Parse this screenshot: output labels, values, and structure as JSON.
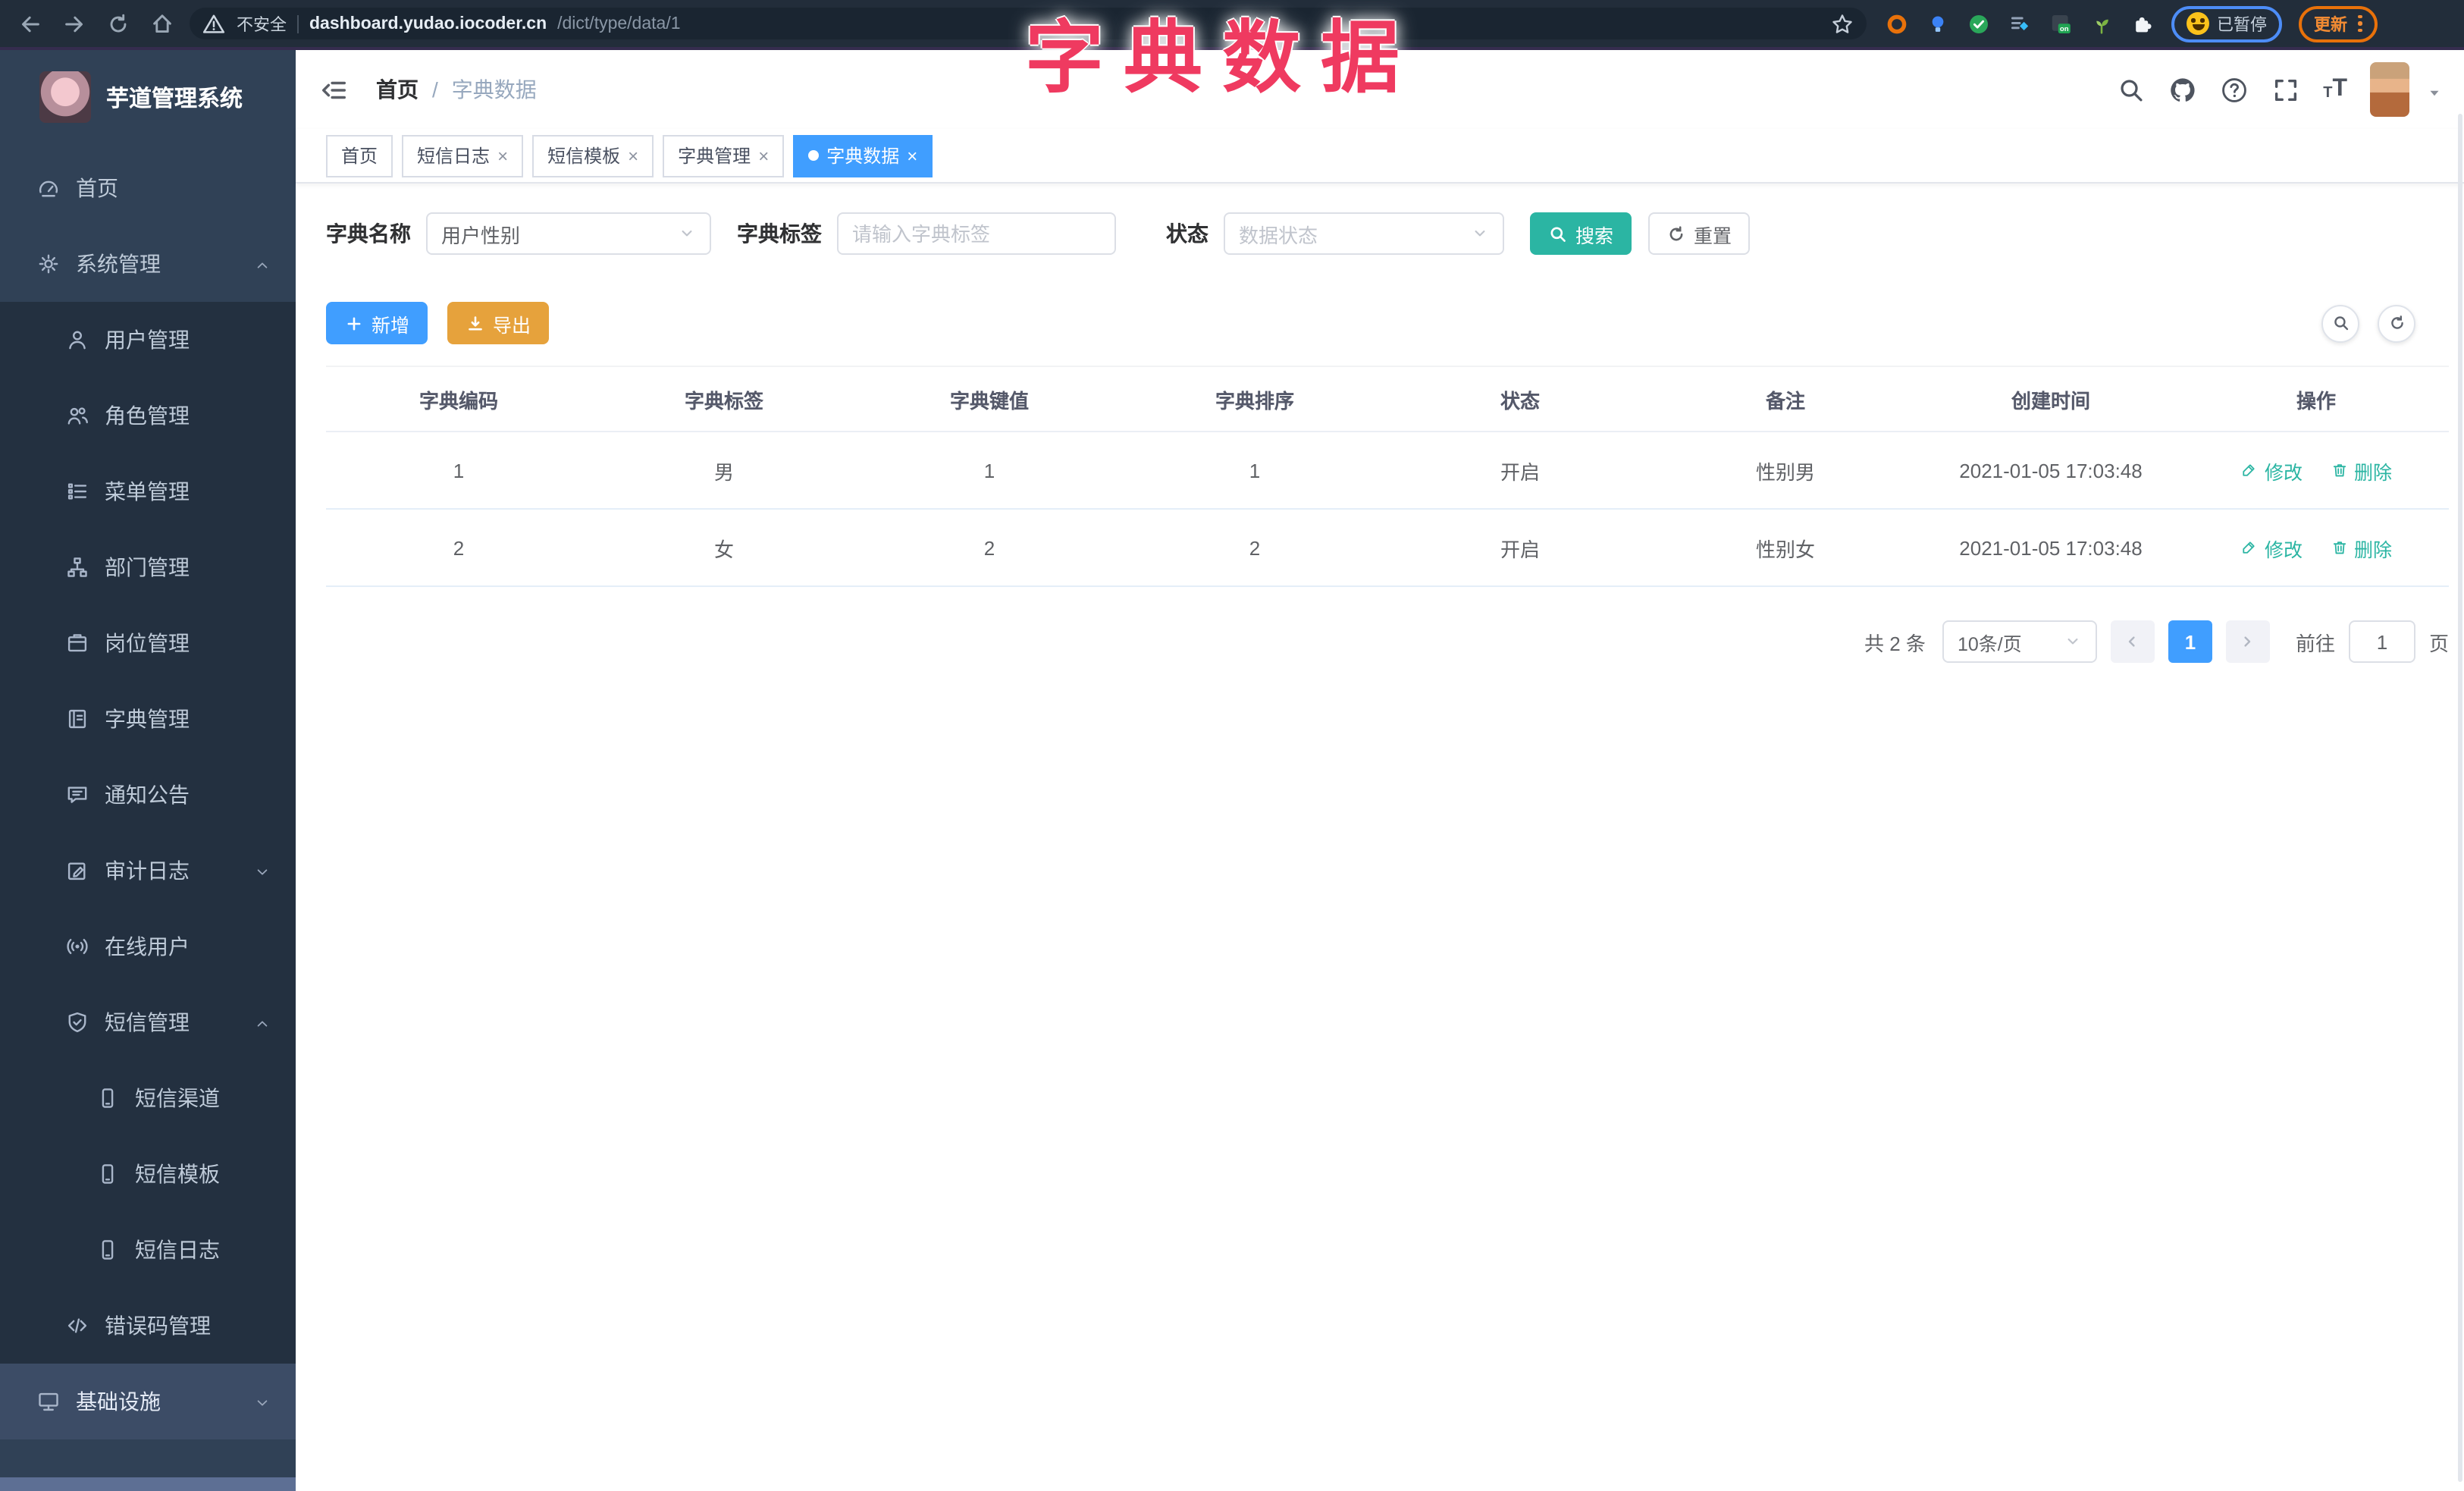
{
  "overlay": {
    "title": "字典数据"
  },
  "browser": {
    "security_text": "不安全",
    "url_domain": "dashboard.yudao.iocoder.cn",
    "url_path": "/dict/type/data/1",
    "paused_badge": "已暂停",
    "update_label": "更新"
  },
  "sidebar": {
    "logo_title": "芋道管理系统",
    "items": [
      {
        "key": "home",
        "label": "首页",
        "icon": "gauge",
        "level": 0
      },
      {
        "key": "system-management",
        "label": "系统管理",
        "icon": "gear",
        "level": 0,
        "chevron": "up"
      },
      {
        "key": "user-management",
        "label": "用户管理",
        "icon": "user",
        "level": 1
      },
      {
        "key": "role-management",
        "label": "角色管理",
        "icon": "users",
        "level": 1
      },
      {
        "key": "menu-management",
        "label": "菜单管理",
        "icon": "menu-list",
        "level": 1
      },
      {
        "key": "dept-management",
        "label": "部门管理",
        "icon": "tree",
        "level": 1
      },
      {
        "key": "post-management",
        "label": "岗位管理",
        "icon": "badge",
        "level": 1
      },
      {
        "key": "dict-management",
        "label": "字典管理",
        "icon": "book",
        "level": 1
      },
      {
        "key": "notice-management",
        "label": "通知公告",
        "icon": "megaphone",
        "level": 1
      },
      {
        "key": "audit-log",
        "label": "审计日志",
        "icon": "log",
        "level": 1,
        "chevron": "down"
      },
      {
        "key": "online-users",
        "label": "在线用户",
        "icon": "online",
        "level": 1
      },
      {
        "key": "sms-management",
        "label": "短信管理",
        "icon": "shield",
        "level": 1,
        "chevron": "up"
      },
      {
        "key": "sms-channel",
        "label": "短信渠道",
        "icon": "phone",
        "level": 2
      },
      {
        "key": "sms-template",
        "label": "短信模板",
        "icon": "phone",
        "level": 2
      },
      {
        "key": "sms-log",
        "label": "短信日志",
        "icon": "phone",
        "level": 2
      },
      {
        "key": "error-code-management",
        "label": "错误码管理",
        "icon": "code",
        "level": 1
      },
      {
        "key": "infrastructure",
        "label": "基础设施",
        "icon": "monitor",
        "level": 0,
        "chevron": "down",
        "highlighted": true
      }
    ]
  },
  "header": {
    "breadcrumb_home": "首页",
    "breadcrumb_sep": "/",
    "breadcrumb_current": "字典数据"
  },
  "tabs": [
    {
      "key": "home",
      "label": "首页",
      "closable": false,
      "active": false
    },
    {
      "key": "sms-log",
      "label": "短信日志",
      "closable": true,
      "active": false
    },
    {
      "key": "sms-template",
      "label": "短信模板",
      "closable": true,
      "active": false
    },
    {
      "key": "dict-management",
      "label": "字典管理",
      "closable": true,
      "active": false
    },
    {
      "key": "dict-data",
      "label": "字典数据",
      "closable": true,
      "active": true
    }
  ],
  "filters": {
    "name_label": "字典名称",
    "name_value": "用户性别",
    "tag_label": "字典标签",
    "tag_placeholder": "请输入字典标签",
    "status_label": "状态",
    "status_placeholder": "数据状态",
    "search_label": "搜索",
    "reset_label": "重置"
  },
  "toolbar": {
    "add_label": "新增",
    "export_label": "导出"
  },
  "table": {
    "headers": [
      "字典编码",
      "字典标签",
      "字典键值",
      "字典排序",
      "状态",
      "备注",
      "创建时间",
      "操作"
    ],
    "rows": [
      [
        "1",
        "男",
        "1",
        "1",
        "开启",
        "性别男",
        "2021-01-05 17:03:48"
      ],
      [
        "2",
        "女",
        "2",
        "2",
        "开启",
        "性别女",
        "2021-01-05 17:03:48"
      ]
    ],
    "edit_label": "修改",
    "delete_label": "删除"
  },
  "pagination": {
    "total": "共 2 条",
    "page_size": "10条/页",
    "current_page": "1",
    "goto_label": "前往",
    "goto_value": "1",
    "page_unit": "页"
  },
  "colors": {
    "primary_teal": "#2bb5a3",
    "primary_blue": "#409eff",
    "warning_orange": "#e6a23c",
    "overlay_pink": "#ef3a60",
    "sidebar_bg": "#304156",
    "submenu_bg": "#233040",
    "tab_active": "#409eff"
  }
}
